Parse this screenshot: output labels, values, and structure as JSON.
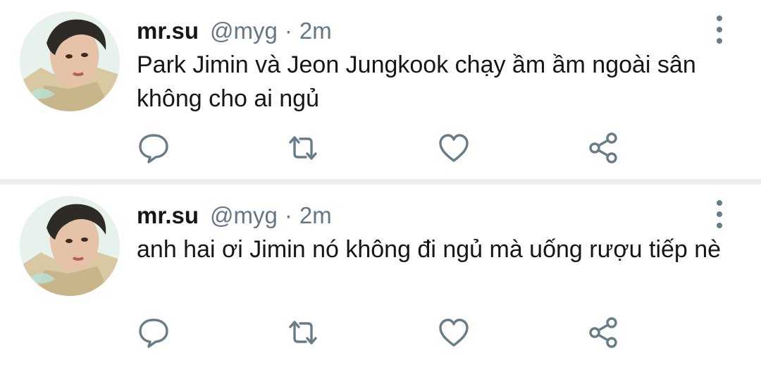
{
  "colors": {
    "text_primary": "#14171a",
    "text_secondary": "#657786",
    "icon": "#687c87",
    "divider": "#eceff1"
  },
  "tweets": [
    {
      "display_name": "mr.su",
      "handle": "@myg",
      "separator": "·",
      "time": "2m",
      "text": "Park Jimin và Jeon Jungkook chạy ầm ầm ngoài sân không cho ai ngủ",
      "actions": [
        "reply-icon",
        "retweet-icon",
        "like-icon",
        "share-icon"
      ]
    },
    {
      "display_name": "mr.su",
      "handle": "@myg",
      "separator": "·",
      "time": "2m",
      "text": "anh hai ơi Jimin nó không đi ngủ mà uống rượu tiếp nè",
      "actions": [
        "reply-icon",
        "retweet-icon",
        "like-icon",
        "share-icon"
      ]
    }
  ]
}
